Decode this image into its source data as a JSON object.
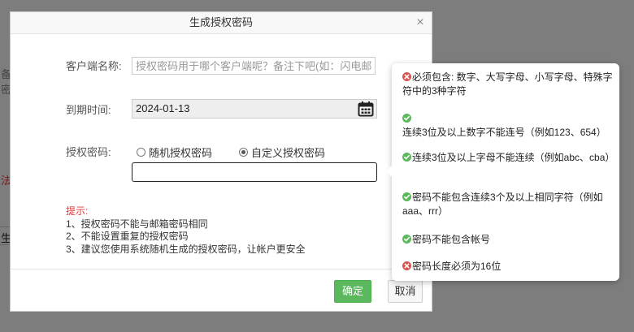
{
  "background": {
    "fragments": [
      "备",
      "密",
      "法",
      "生"
    ]
  },
  "dialog": {
    "title": "生成授权密码",
    "close_icon": "×",
    "client_name": {
      "label": "客户端名称:",
      "placeholder": "授权密码用于哪个客户端呢？备注下吧(如：闪电邮)",
      "value": ""
    },
    "expiry": {
      "label": "到期时间:",
      "value": "2024-01-13"
    },
    "password": {
      "label": "授权密码:",
      "option_random": "随机授权密码",
      "option_custom": "自定义授权密码",
      "selected": "custom",
      "value": ""
    },
    "tips": {
      "title": "提示:",
      "items": [
        "1、授权密码不能与邮箱密码相同",
        "2、不能设置重复的授权密码",
        "3、建议您使用系统随机生成的授权密码，让帐户更安全"
      ]
    },
    "ok_label": "确定",
    "cancel_label": "取消"
  },
  "password_rules": [
    {
      "status": "error",
      "text": "必须包含: 数字、大写字母、小写字母、特殊字符中的3种字符"
    },
    {
      "status": "ok",
      "text": "连续3位及以上数字不能连号（例如123、654）"
    },
    {
      "status": "ok",
      "text": "连续3位及以上字母不能连续（例如abc、cba）"
    },
    {
      "status": "ok",
      "text": "密码不能包含连续3个及以上相同字符（例如aaa、rrr）"
    },
    {
      "status": "ok",
      "text": "密码不能包含帐号"
    },
    {
      "status": "error",
      "text": "密码长度必须为16位"
    }
  ],
  "colors": {
    "ok": "#5cb85c",
    "error": "#d9534f",
    "tip_title": "#e4393c",
    "overlay": "#7d7d7d"
  }
}
